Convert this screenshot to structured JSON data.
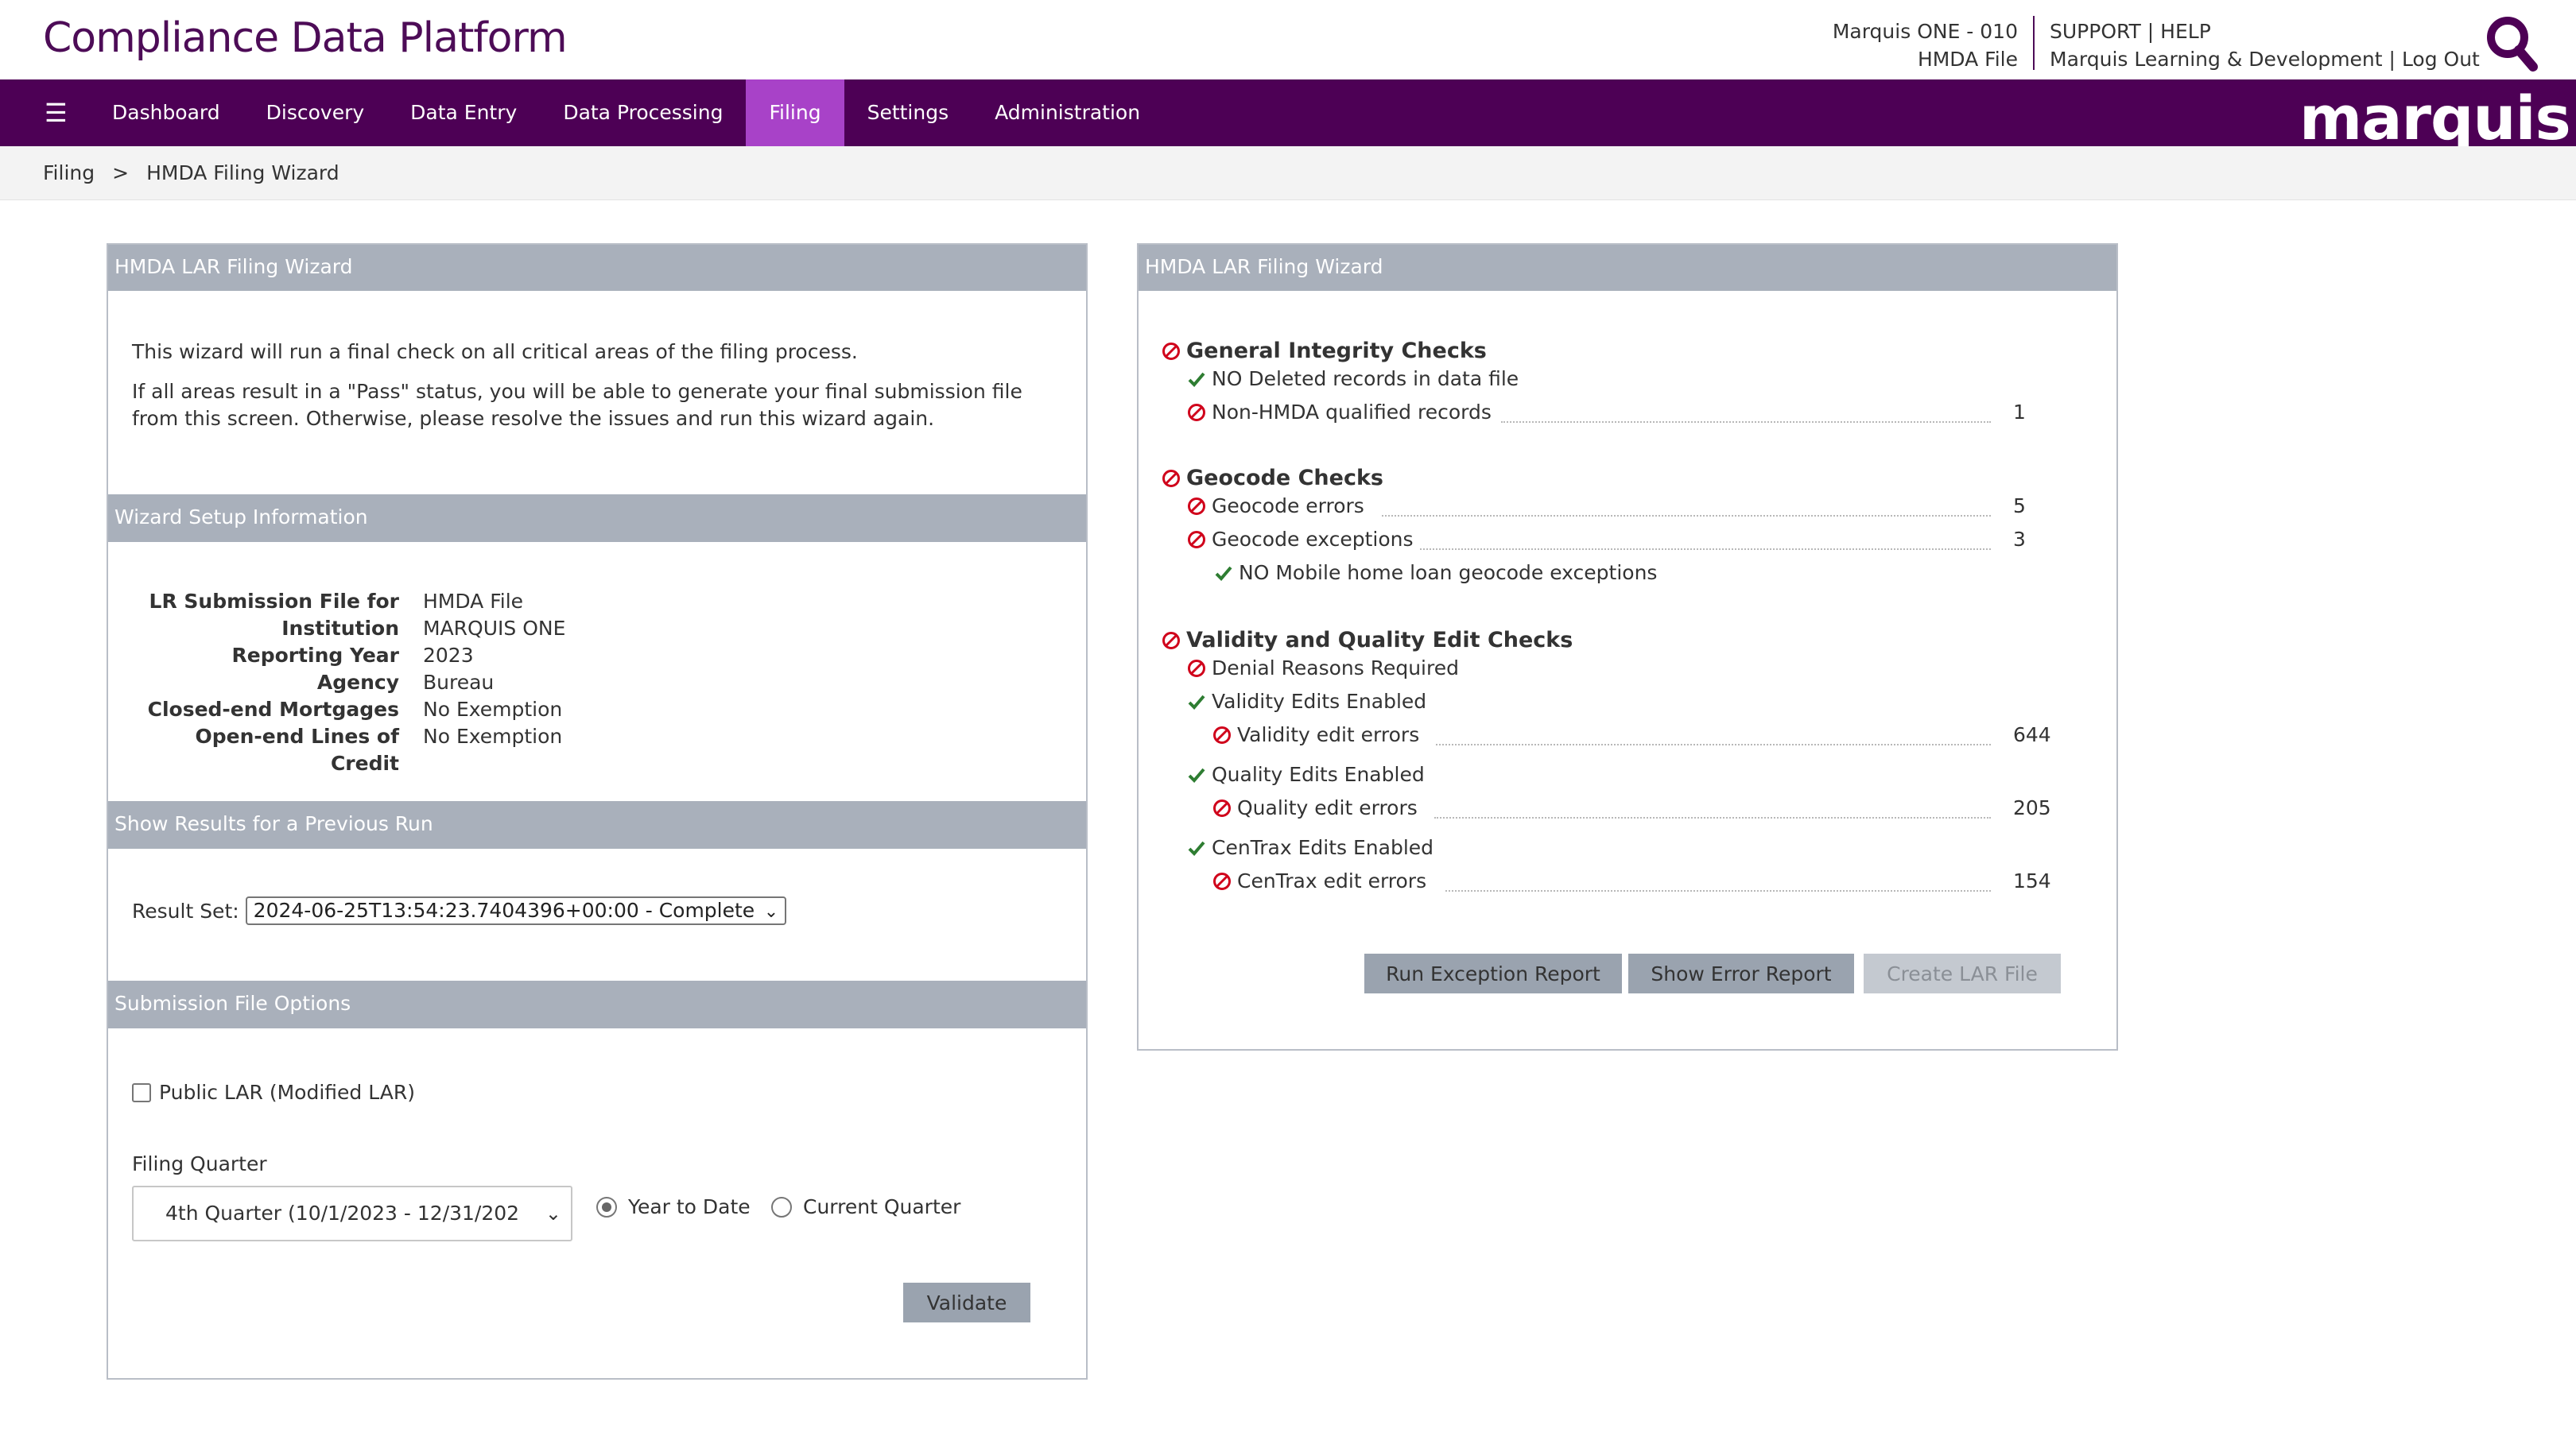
{
  "header": {
    "title": "Compliance Data Platform",
    "account_line1": "Marquis ONE - 010",
    "account_line2": "HMDA File",
    "support": "SUPPORT",
    "help": "HELP",
    "pipe": "|",
    "org": "Marquis Learning & Development",
    "logout": "Log Out"
  },
  "nav": {
    "items": [
      "Dashboard",
      "Discovery",
      "Data Entry",
      "Data Processing",
      "Filing",
      "Settings",
      "Administration"
    ],
    "active": "Filing",
    "logo": "marquis"
  },
  "breadcrumb": {
    "parent": "Filing",
    "separator": ">",
    "current": "HMDA Filing Wizard"
  },
  "left_panel": {
    "title": "HMDA LAR Filing Wizard",
    "intro1": "This wizard will run a final check on all critical areas of the filing process.",
    "intro2": "If all areas result in a \"Pass\" status, you will be able to generate your final submission file from this screen. Otherwise, please resolve the issues and run this wizard again.",
    "setup_title": "Wizard Setup Information",
    "setup": [
      {
        "label": "LR Submission File for",
        "value": "HMDA File"
      },
      {
        "label": "Institution",
        "value": "MARQUIS ONE"
      },
      {
        "label": "Reporting Year",
        "value": "2023"
      },
      {
        "label": "Agency",
        "value": "Bureau"
      },
      {
        "label": "Closed-end Mortgages",
        "value": "No Exemption"
      },
      {
        "label": "Open-end Lines of Credit",
        "value": "No Exemption"
      }
    ],
    "previous_title": "Show Results for a Previous Run",
    "result_label": "Result Set:",
    "result_value": "2024-06-25T13:54:23.7404396+00:00 - Complete",
    "options_title": "Submission File Options",
    "public_lar": "Public LAR (Modified LAR)",
    "filing_quarter_label": "Filing Quarter",
    "filing_quarter_value": "4th Quarter (10/1/2023 - 12/31/202",
    "radio_ytd": "Year to Date",
    "radio_current": "Current Quarter",
    "validate": "Validate"
  },
  "right_panel": {
    "title": "HMDA LAR Filing Wizard",
    "groups": {
      "integrity": {
        "title": "General Integrity Checks",
        "deleted": "NO Deleted records in data file",
        "non_hmda": "Non-HMDA qualified records",
        "non_hmda_count": "1"
      },
      "geocode": {
        "title": "Geocode Checks",
        "errors": "Geocode errors",
        "errors_count": "5",
        "exceptions": "Geocode exceptions",
        "exceptions_count": "3",
        "mobile": "NO Mobile home loan geocode exceptions"
      },
      "validity": {
        "title": "Validity and Quality Edit Checks",
        "denial": "Denial Reasons Required",
        "validity_enabled": "Validity Edits Enabled",
        "validity_errors": "Validity edit errors",
        "validity_count": "644",
        "quality_enabled": "Quality Edits Enabled",
        "quality_errors": "Quality edit errors",
        "quality_count": "205",
        "centrax_enabled": "CenTrax Edits Enabled",
        "centrax_errors": "CenTrax edit errors",
        "centrax_count": "154"
      }
    },
    "buttons": {
      "exception": "Run Exception Report",
      "error": "Show Error Report",
      "create": "Create LAR File"
    }
  },
  "colors": {
    "brand": "#4d0055",
    "active_tab": "#a842c8",
    "fail": "#d0021b",
    "pass": "#2e7d32"
  }
}
